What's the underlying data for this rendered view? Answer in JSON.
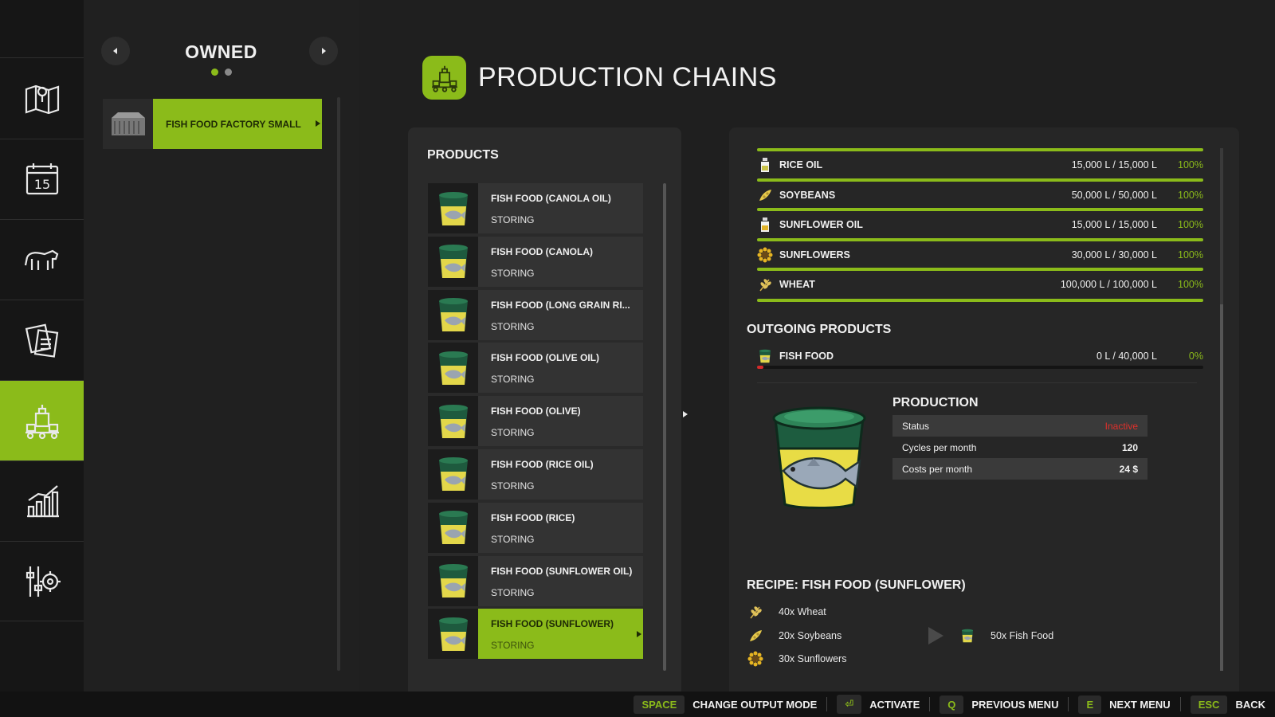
{
  "colors": {
    "accent": "#8bbb1a",
    "inactive": "#e0302b",
    "background": "#1f1f1f"
  },
  "nav": {
    "items": [
      {
        "icon": "map-icon"
      },
      {
        "icon": "calendar-icon",
        "label": "15"
      },
      {
        "icon": "animals-icon"
      },
      {
        "icon": "contracts-icon"
      },
      {
        "icon": "production-icon",
        "active": true
      },
      {
        "icon": "statistics-icon"
      },
      {
        "icon": "settings-icon"
      }
    ]
  },
  "owned": {
    "title": "OWNED",
    "page_dots": 2,
    "active_dot": 1,
    "factory": {
      "name": "FISH FOOD FACTORY SMALL",
      "icon": "factory-thumbnail"
    }
  },
  "header": {
    "title": "PRODUCTION CHAINS",
    "icon": "production-icon"
  },
  "products": {
    "title": "PRODUCTS",
    "items": [
      {
        "name": "FISH FOOD (CANOLA OIL)",
        "status": "STORING"
      },
      {
        "name": "FISH FOOD (CANOLA)",
        "status": "STORING"
      },
      {
        "name": "FISH FOOD (LONG GRAIN RI...",
        "status": "STORING"
      },
      {
        "name": "FISH FOOD (OLIVE OIL)",
        "status": "STORING"
      },
      {
        "name": "FISH FOOD (OLIVE)",
        "status": "STORING"
      },
      {
        "name": "FISH FOOD (RICE OIL)",
        "status": "STORING"
      },
      {
        "name": "FISH FOOD (RICE)",
        "status": "STORING"
      },
      {
        "name": "FISH FOOD (SUNFLOWER OIL)",
        "status": "STORING"
      },
      {
        "name": "FISH FOOD (SUNFLOWER)",
        "status": "STORING",
        "selected": true
      }
    ]
  },
  "inputs": [
    {
      "name": "RICE OIL",
      "amount": "15,000 L / 15,000 L",
      "percent": "100%",
      "icon": "oil-bottle-icon"
    },
    {
      "name": "SOYBEANS",
      "amount": "50,000 L / 50,000 L",
      "percent": "100%",
      "icon": "soybean-icon"
    },
    {
      "name": "SUNFLOWER OIL",
      "amount": "15,000 L / 15,000 L",
      "percent": "100%",
      "icon": "oil-bottle-icon"
    },
    {
      "name": "SUNFLOWERS",
      "amount": "30,000 L / 30,000 L",
      "percent": "100%",
      "icon": "sunflower-icon"
    },
    {
      "name": "WHEAT",
      "amount": "100,000 L / 100,000 L",
      "percent": "100%",
      "icon": "wheat-icon"
    }
  ],
  "outgoing": {
    "title": "OUTGOING PRODUCTS",
    "items": [
      {
        "name": "FISH FOOD",
        "amount": "0 L / 40,000 L",
        "percent": "0%",
        "fill": 0.0,
        "icon": "fish-food-icon"
      }
    ]
  },
  "production": {
    "title": "PRODUCTION",
    "rows": [
      {
        "label": "Status",
        "value": "Inactive",
        "inactive": true
      },
      {
        "label": "Cycles per month",
        "value": "120"
      },
      {
        "label": "Costs per month",
        "value": "24 $"
      }
    ]
  },
  "recipe": {
    "title": "RECIPE: FISH FOOD (SUNFLOWER)",
    "inputs": [
      {
        "text": "40x Wheat",
        "icon": "wheat-icon"
      },
      {
        "text": "20x Soybeans",
        "icon": "soybean-icon"
      },
      {
        "text": "30x Sunflowers",
        "icon": "sunflower-icon"
      }
    ],
    "output": {
      "text": "50x Fish Food",
      "icon": "fish-food-icon"
    }
  },
  "footer": [
    {
      "key": "SPACE",
      "label": "CHANGE OUTPUT MODE"
    },
    {
      "key": "⏎",
      "label": "ACTIVATE"
    },
    {
      "key": "Q",
      "label": "PREVIOUS MENU"
    },
    {
      "key": "E",
      "label": "NEXT MENU"
    },
    {
      "key": "ESC",
      "label": "BACK"
    }
  ]
}
